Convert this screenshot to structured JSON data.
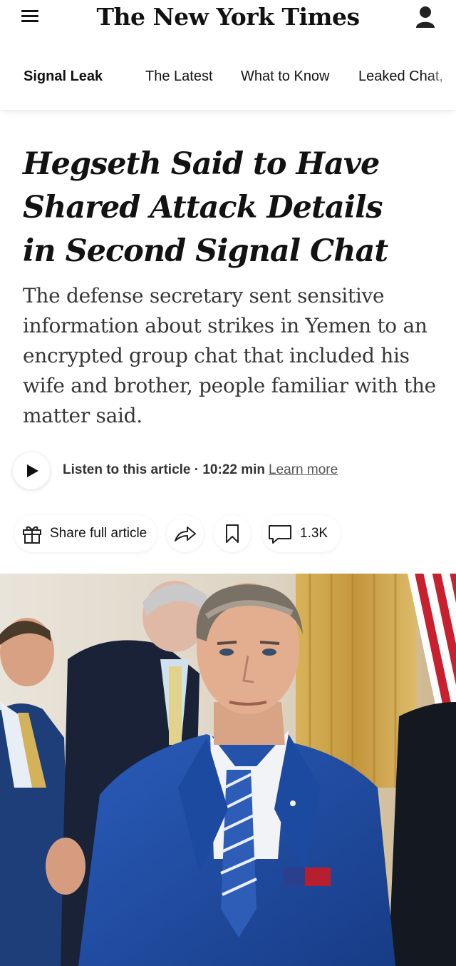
{
  "header": {
    "logo_text": "The New York Times",
    "menu_icon": "hamburger-icon",
    "account_icon": "account-icon"
  },
  "nav": {
    "items": [
      {
        "label": "Signal Leak",
        "active": true
      },
      {
        "label": "The Latest",
        "active": false
      },
      {
        "label": "What to Know",
        "active": false
      },
      {
        "label": "Leaked Chat,",
        "active": false
      }
    ]
  },
  "article": {
    "headline_lines": [
      "Hegseth Said to Have",
      "Shared Attack Details",
      "in Second Signal Chat"
    ],
    "summary": "The defense secretary sent sensitive information about strikes in Yemen to an encrypted group chat that included his wife and brother, people familiar with the matter said."
  },
  "audio": {
    "listen_label": "Listen to this article · 10:22 min",
    "learn_more": "Learn more",
    "play_icon": "play-icon"
  },
  "actions": {
    "share_label": "Share full article",
    "share_icon": "gift-icon",
    "forward_icon": "share-arrow-icon",
    "bookmark_icon": "bookmark-icon",
    "comment_icon": "comment-icon",
    "comment_count": "1.3K"
  },
  "colors": {
    "text": "#121212",
    "summary_text": "#363636",
    "suit_blue": "#1f4fa8",
    "curtain_gold": "#c9a04a"
  }
}
